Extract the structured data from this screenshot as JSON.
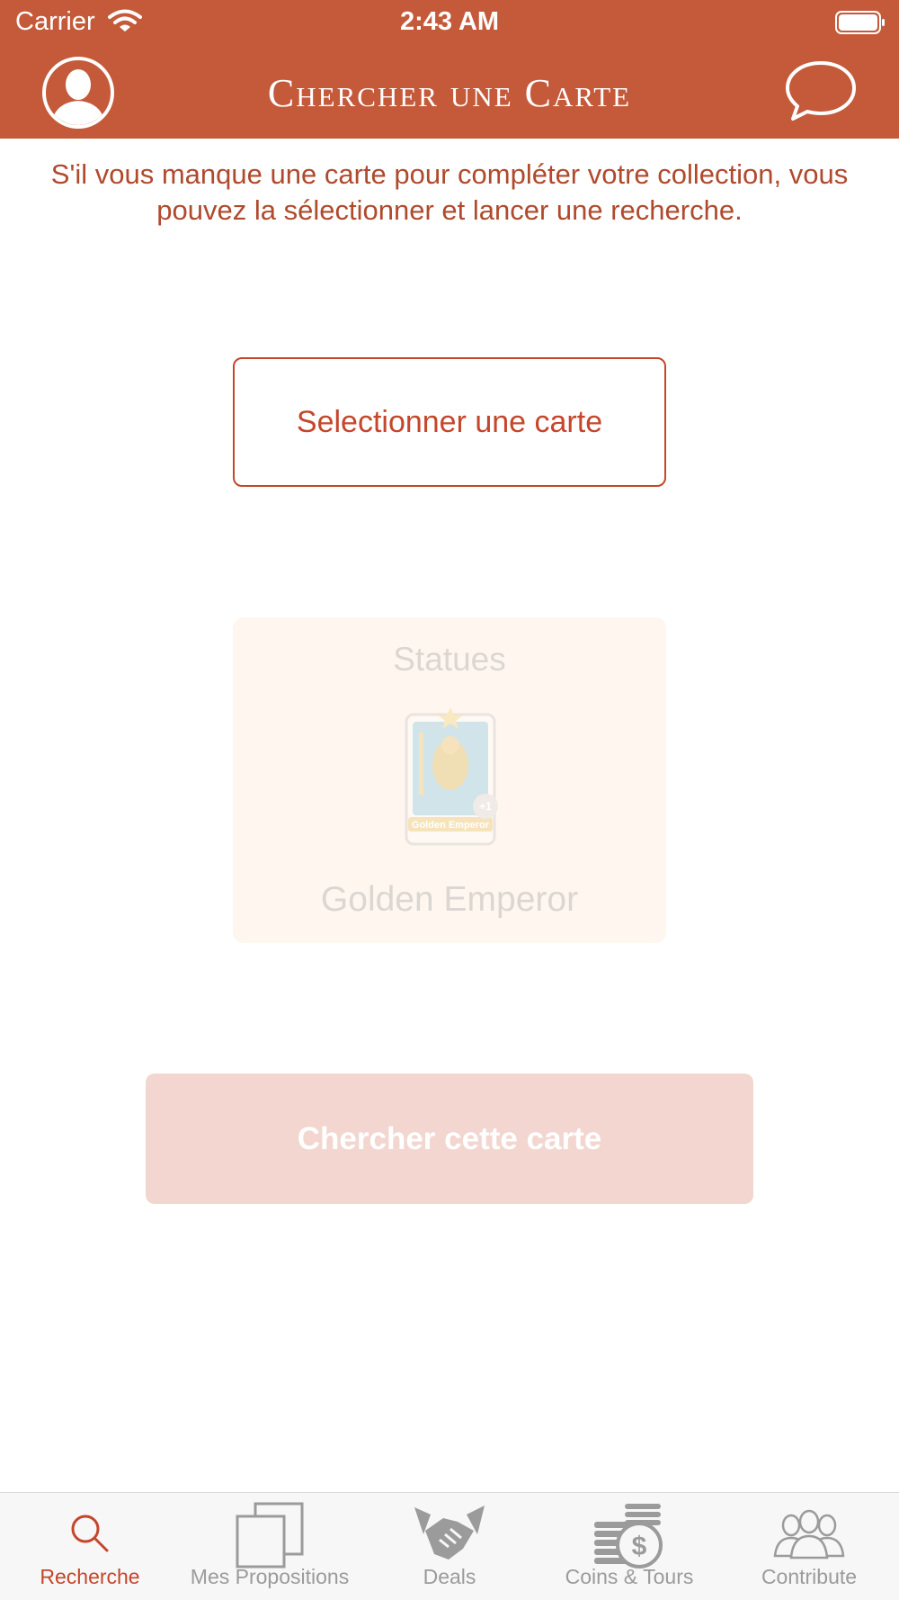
{
  "status_bar": {
    "carrier": "Carrier",
    "time": "2:43 AM"
  },
  "header": {
    "title": "Chercher une Carte",
    "left_icon": "profile-icon",
    "right_icon": "chat-icon",
    "background": "#c45a3a"
  },
  "intro": {
    "text": "S'il vous manque une carte pour compléter votre collection, vous pouvez la sélectionner et lancer une recherche."
  },
  "select_button": {
    "label": "Selectionner une carte"
  },
  "card": {
    "category": "Statues",
    "name": "Golden Emperor",
    "image_caption": "Golden Emperor",
    "badge": "+1"
  },
  "search_button": {
    "label": "Chercher cette carte"
  },
  "tabbar": {
    "active_color": "#c5462b",
    "inactive_color": "#9b9b9b",
    "tabs": [
      {
        "label": "Recherche",
        "icon": "search-icon",
        "active": true
      },
      {
        "label": "Mes Propositions",
        "icon": "stacked-cards-icon",
        "active": false
      },
      {
        "label": "Deals",
        "icon": "handshake-icon",
        "active": false
      },
      {
        "label": "Coins & Tours",
        "icon": "coins-icon",
        "active": false
      },
      {
        "label": "Contribute",
        "icon": "people-icon",
        "active": false
      }
    ]
  }
}
